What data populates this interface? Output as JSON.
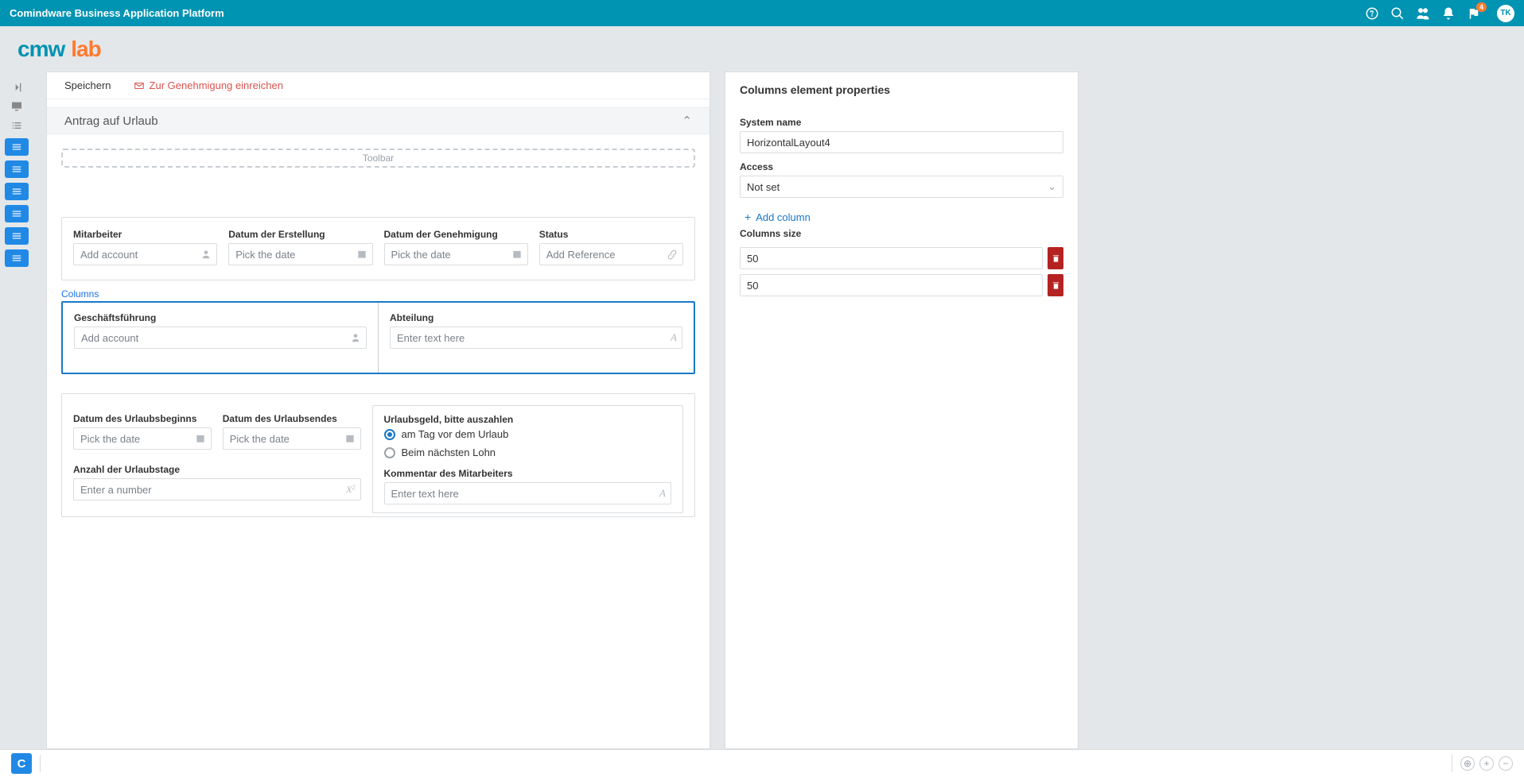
{
  "topbar": {
    "title": "Comindware Business Application Platform",
    "notif_badge": "4",
    "avatar_initials": "TK"
  },
  "logo": {
    "part1": "cmw",
    "part2": "lab"
  },
  "toolbar": {
    "save_label": "Speichern",
    "submit_label": "Zur Genehmigung einreichen"
  },
  "section": {
    "title": "Antrag auf Urlaub"
  },
  "drop": {
    "toolbar_label": "Toolbar"
  },
  "fields": {
    "mitarbeiter": {
      "label": "Mitarbeiter",
      "placeholder": "Add account"
    },
    "erstellt": {
      "label": "Datum der Erstellung",
      "placeholder": "Pick the date"
    },
    "genehmigung": {
      "label": "Datum der Genehmigung",
      "placeholder": "Pick the date"
    },
    "status": {
      "label": "Status",
      "placeholder": "Add Reference"
    },
    "columns_label": "Columns",
    "geschaeftsfuehrung": {
      "label": "Geschäftsführung",
      "placeholder": "Add account"
    },
    "abteilung": {
      "label": "Abteilung",
      "placeholder": "Enter text here"
    },
    "beginn": {
      "label": "Datum des Urlaubsbeginns",
      "placeholder": "Pick the date"
    },
    "ende": {
      "label": "Datum des Urlaubsendes",
      "placeholder": "Pick the date"
    },
    "tage": {
      "label": "Anzahl der Urlaubstage",
      "placeholder": "Enter a number"
    },
    "urlaubsgeld": {
      "label": "Urlaubsgeld, bitte auszahlen"
    },
    "radio1": "am Tag vor dem Urlaub",
    "radio2": "Beim nächsten Lohn",
    "kommentar": {
      "label": "Kommentar des Mitarbeiters",
      "placeholder": "Enter text here"
    }
  },
  "props": {
    "title": "Columns element properties",
    "sysname_label": "System name",
    "sysname_value": "HorizontalLayout4",
    "access_label": "Access",
    "access_value": "Not set",
    "addcol_label": "Add column",
    "colsize_label": "Columns size",
    "size1": "50",
    "size2": "50"
  },
  "bottom": {
    "badge": "C"
  }
}
